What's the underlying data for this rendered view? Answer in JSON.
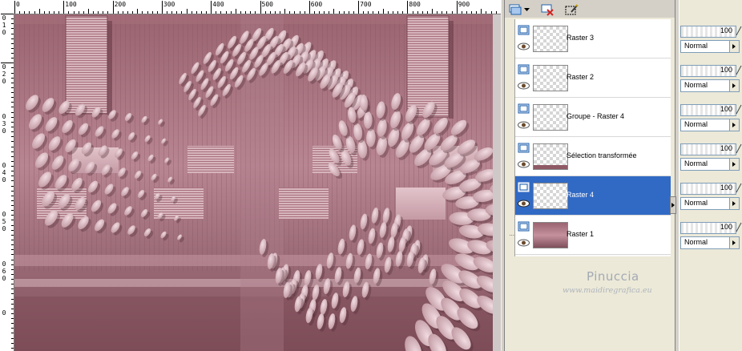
{
  "ruler": {
    "top_labels": [
      "0",
      "100",
      "200",
      "300",
      "400",
      "500",
      "600",
      "700",
      "800",
      "900"
    ],
    "left_labels": [
      "0",
      "1",
      "0",
      "0",
      "2",
      "0",
      "0",
      "3",
      "0",
      "0",
      "4",
      "0",
      "0",
      "5",
      "0",
      "0",
      "6",
      "0",
      "0"
    ]
  },
  "toolbar": {
    "icons": [
      "new-layer-icon",
      "dropdown-arrow-icon",
      "delete-layer-icon",
      "edit-mask-icon"
    ]
  },
  "layers": [
    {
      "name": "Raster 3",
      "selected": false
    },
    {
      "name": "Raster 2",
      "selected": false
    },
    {
      "name": "Groupe - Raster 4",
      "selected": false
    },
    {
      "name": "Sélection transformée",
      "selected": false
    },
    {
      "name": "Raster 4",
      "selected": true
    },
    {
      "name": "Raster 1",
      "selected": false
    }
  ],
  "properties": [
    {
      "opacity": "100",
      "blend": "Normal"
    },
    {
      "opacity": "100",
      "blend": "Normal"
    },
    {
      "opacity": "100",
      "blend": "Normal"
    },
    {
      "opacity": "100",
      "blend": "Normal"
    },
    {
      "opacity": "100",
      "blend": "Normal"
    },
    {
      "opacity": "100",
      "blend": "Normal"
    }
  ],
  "watermark": {
    "name": "Pinuccia",
    "url": "www.maidiregrafica.eu"
  },
  "colors": {
    "selection": "#316ac5",
    "canvas_base": "#8f5a65",
    "canvas_light": "#d2aab4"
  }
}
